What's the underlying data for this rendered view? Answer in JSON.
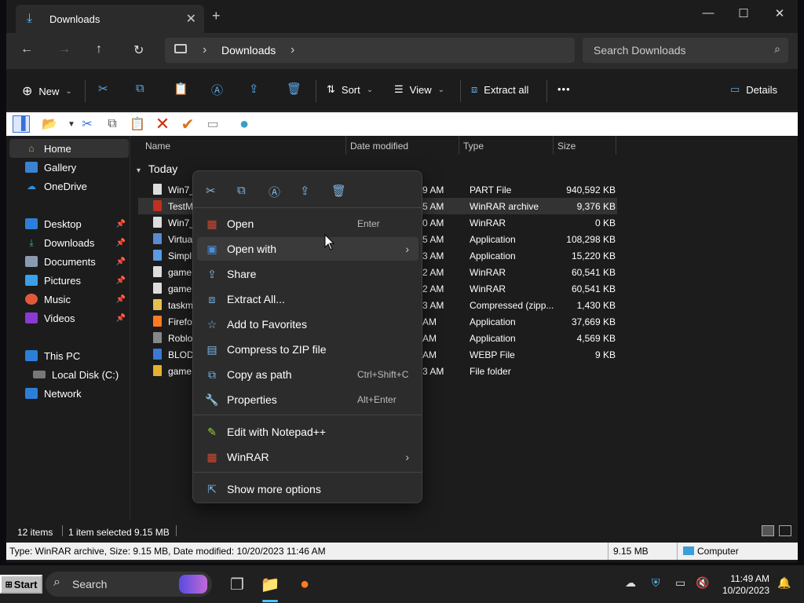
{
  "window": {
    "tab_title": "Downloads",
    "new_tab": "+",
    "minimize": "—",
    "maximize": "☐",
    "close": "✕"
  },
  "nav": {
    "back": "←",
    "forward": "→",
    "up": "↑",
    "refresh": "↻",
    "breadcrumb": [
      "Downloads"
    ],
    "chev": "›",
    "search_placeholder": "Search Downloads"
  },
  "toolbar": {
    "new_label": "New",
    "sort_label": "Sort",
    "view_label": "View",
    "extract_label": "Extract all",
    "more": "•••",
    "details_label": "Details"
  },
  "sidebar": {
    "home": "Home",
    "gallery": "Gallery",
    "onedrive": "OneDrive",
    "pinned": [
      "Desktop",
      "Downloads",
      "Documents",
      "Pictures",
      "Music",
      "Videos"
    ],
    "thispc": "This PC",
    "localdisk": "Local Disk (C:)",
    "network": "Network"
  },
  "columns": {
    "name": "Name",
    "date": "Date modified",
    "type": "Type",
    "size": "Size"
  },
  "group": "Today",
  "files": [
    {
      "name": "Win7_",
      "date": "9 AM",
      "type": "PART File",
      "size": "940,592 KB"
    },
    {
      "name": "TestM",
      "date": "5 AM",
      "type": "WinRAR archive",
      "size": "9,376 KB"
    },
    {
      "name": "Win7_",
      "date": "0 AM",
      "type": "WinRAR",
      "size": "0 KB"
    },
    {
      "name": "Virtua",
      "date": "5 AM",
      "type": "Application",
      "size": "108,298 KB"
    },
    {
      "name": "Simpl",
      "date": "3 AM",
      "type": "Application",
      "size": "15,220 KB"
    },
    {
      "name": "game",
      "date": "2 AM",
      "type": "WinRAR",
      "size": "60,541 KB"
    },
    {
      "name": "game",
      "date": "2 AM",
      "type": "WinRAR",
      "size": "60,541 KB"
    },
    {
      "name": "taskm",
      "date": "3 AM",
      "type": "Compressed (zipp...",
      "size": "1,430 KB"
    },
    {
      "name": "Firefo",
      "date": "AM",
      "type": "Application",
      "size": "37,669 KB"
    },
    {
      "name": "Roblo",
      "date": "AM",
      "type": "Application",
      "size": "4,569 KB"
    },
    {
      "name": "BLOD",
      "date": "AM",
      "type": "WEBP File",
      "size": "9 KB"
    },
    {
      "name": "game",
      "date": "3 AM",
      "type": "File folder",
      "size": ""
    }
  ],
  "menu": {
    "items": [
      {
        "label": "Open",
        "shortcut": "Enter"
      },
      {
        "label": "Open with",
        "shortcut": ""
      },
      {
        "label": "Share",
        "shortcut": ""
      },
      {
        "label": "Extract All...",
        "shortcut": ""
      },
      {
        "label": "Add to Favorites",
        "shortcut": ""
      },
      {
        "label": "Compress to ZIP file",
        "shortcut": ""
      },
      {
        "label": "Copy as path",
        "shortcut": "Ctrl+Shift+C"
      },
      {
        "label": "Properties",
        "shortcut": "Alt+Enter"
      },
      {
        "label": "Edit with Notepad++",
        "shortcut": ""
      },
      {
        "label": "WinRAR",
        "shortcut": ""
      },
      {
        "label": "Show more options",
        "shortcut": ""
      }
    ]
  },
  "status": {
    "count": "12 items",
    "selected": "1 item selected  9.15 MB",
    "bar_text": "Type: WinRAR archive, Size: 9.15 MB, Date modified: 10/20/2023 11:46 AM",
    "bar_size": "9.15 MB",
    "bar_loc": "Computer"
  },
  "taskbar": {
    "start": "Start",
    "search": "Search",
    "time": "11:49 AM",
    "date": "10/20/2023"
  },
  "colors": {
    "accent": "#5aa8e8",
    "selection": "#333333"
  }
}
